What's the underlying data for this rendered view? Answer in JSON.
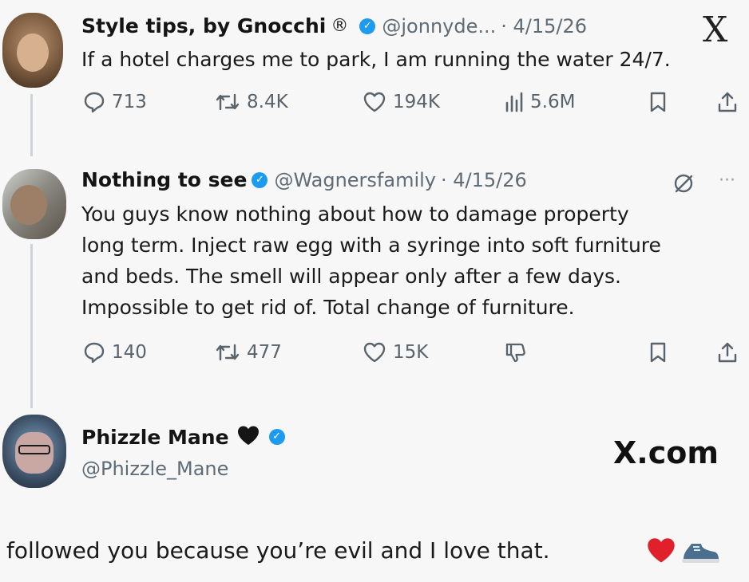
{
  "tweet1": {
    "name": "Style tips, by Gnocchi",
    "registered_mark": "®",
    "handle": "@jonnyde...",
    "date": "· 4/15/26",
    "text": "If a hotel charges me to park, I am running the water 24/7.",
    "replies": "713",
    "reposts": "8.4K",
    "likes": "194K",
    "views": "5.6M",
    "x_logo": "X"
  },
  "tweet2": {
    "name": "Nothing to see",
    "handle": "@Wagnersfamily",
    "date": "· 4/15/26",
    "text_lines": [
      "You guys know nothing about how to damage property",
      "long term. Inject raw egg with a syringe into soft furniture",
      "and beds. The smell will appear only after a few days.",
      "Impossible to get rid of. Total change of furniture."
    ],
    "replies": "140",
    "reposts": "477",
    "likes": "15K",
    "more": "···"
  },
  "tweet3": {
    "name": "Phizzle Mane",
    "handle": "@Phizzle_Mane",
    "watermark": "X.com",
    "text": "followed you because you’re evil and I love that."
  },
  "colors": {
    "verified": "#1d9bf0",
    "background": "#f7f7f8",
    "heart_red": "#e0202a"
  }
}
